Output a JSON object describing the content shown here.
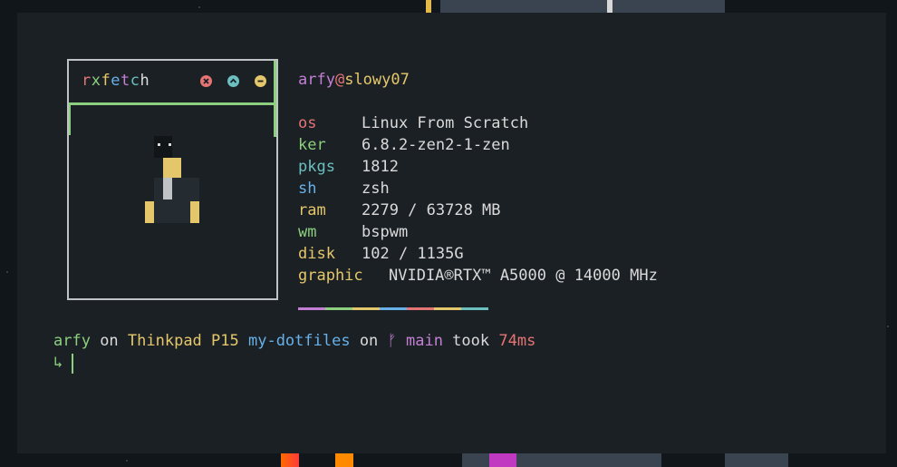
{
  "colors": {
    "green": "#8ccf7e",
    "yellow": "#e5c76b",
    "blue": "#67b0e8",
    "magenta": "#c47fd5",
    "red": "#e57474",
    "cyan": "#6cbfbf",
    "fg": "#dadada",
    "bg": "#1b2024"
  },
  "box": {
    "title_chars": [
      "r",
      "x",
      "f",
      "e",
      "t",
      "c",
      "h"
    ],
    "buttons": [
      "close-icon",
      "maximize-icon",
      "minimize-icon"
    ]
  },
  "info": {
    "user": "arfy",
    "at": "@",
    "host": "slowy07",
    "rows": [
      {
        "key": "os",
        "value": "Linux From Scratch"
      },
      {
        "key": "ker",
        "value": "6.8.2-zen2-1-zen"
      },
      {
        "key": "pkgs",
        "value": "1812"
      },
      {
        "key": "sh",
        "value": "zsh"
      },
      {
        "key": "ram",
        "value": "2279 / 63728 MB"
      },
      {
        "key": "wm",
        "value": "bspwm"
      },
      {
        "key": "disk",
        "value": "102 / 1135G"
      },
      {
        "key": "graphic",
        "value": "NVIDIA®RTX™ A5000 @ 14000 MHz"
      }
    ]
  },
  "prompt": {
    "user": "arfy",
    "on1": " on ",
    "machine": "Thinkpad P15",
    "dir": "my-dotfiles",
    "on2": " on ",
    "branch_icon": "ᚠ",
    "branch": "main",
    "took": " took ",
    "duration": "74ms",
    "arrow": "↳"
  }
}
